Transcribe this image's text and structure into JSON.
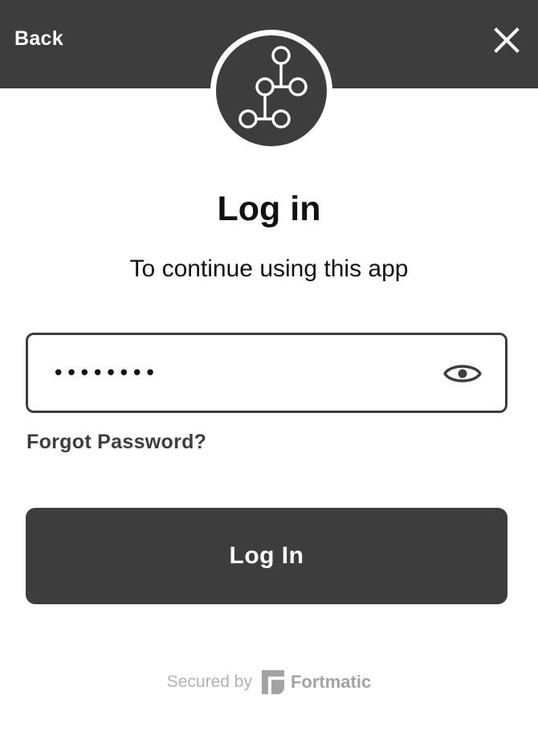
{
  "header": {
    "back_label": "Back",
    "close_icon": "close-icon",
    "app_logo_icon": "workflow-nodes-icon"
  },
  "main": {
    "title": "Log in",
    "subtitle": "To continue using this app",
    "password": {
      "value": "••••••••",
      "toggle_icon": "eye-icon"
    },
    "forgot_label": "Forgot Password?",
    "submit_label": "Log In"
  },
  "footer": {
    "secured_text": "Secured by",
    "brand_name": "Fortmatic",
    "brand_icon": "fortmatic-logo-icon"
  },
  "colors": {
    "primary": "#3d3d3d",
    "background": "#ffffff",
    "text": "#111111",
    "muted": "#b2b2b2"
  }
}
